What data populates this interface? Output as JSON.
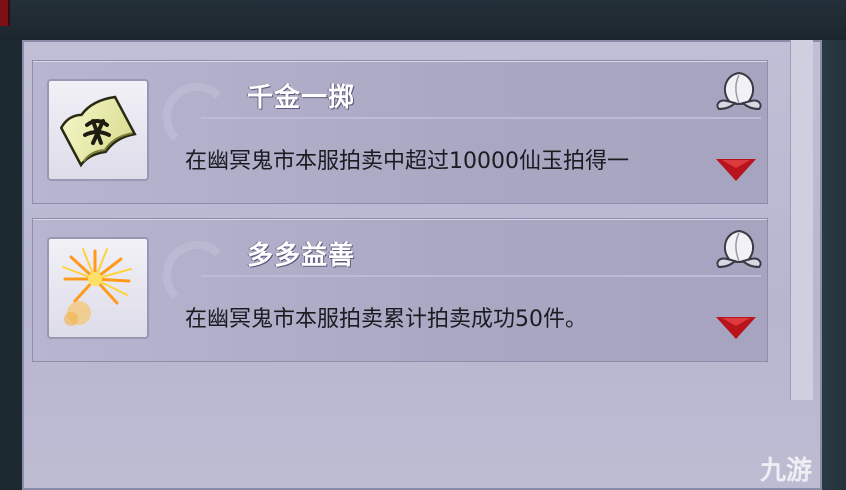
{
  "achievements": [
    {
      "title": "千金一掷",
      "description": "在幽冥鬼市本服拍卖中超过10000仙玉拍得一",
      "icon": "paper-note-icon"
    },
    {
      "title": "多多益善",
      "description": "在幽冥鬼市本服拍卖累计拍卖成功50件。",
      "icon": "fireworks-icon"
    }
  ],
  "reward_icon": "peach-icon",
  "colors": {
    "panel": "#b9b8d0",
    "arrow": "#b8141d",
    "title": "#ffffff",
    "text": "#1b1b22"
  },
  "watermark": "九游"
}
